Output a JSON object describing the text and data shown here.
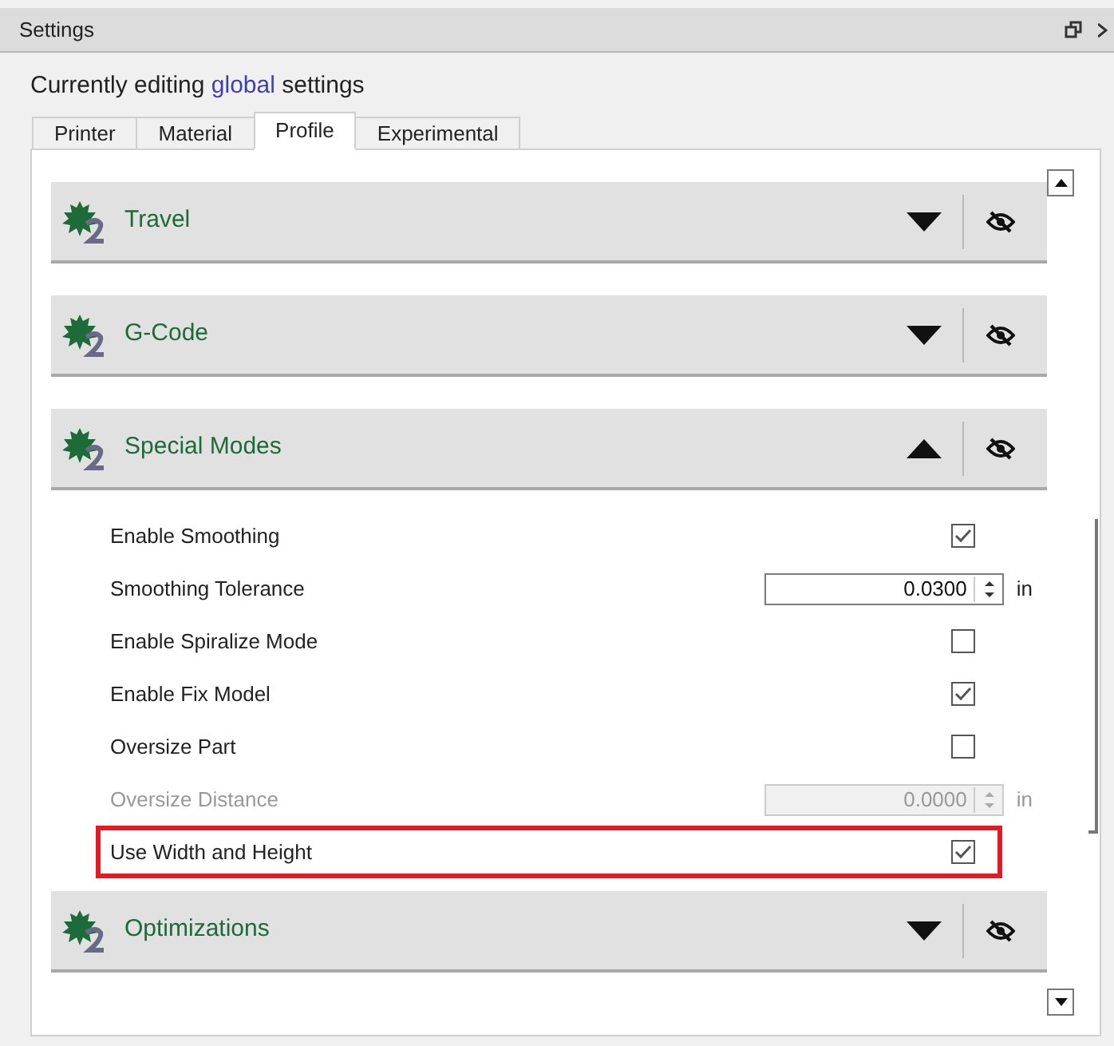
{
  "window": {
    "title": "Settings"
  },
  "editing": "Currently editing **global** settings",
  "tabs": [
    {
      "label": "Printer",
      "selected": false
    },
    {
      "label": "Material",
      "selected": false
    },
    {
      "label": "Profile",
      "selected": true
    },
    {
      "label": "Experimental",
      "selected": false
    }
  ],
  "sections": [
    {
      "title": "Travel",
      "expanded": false
    },
    {
      "title": "G-Code",
      "expanded": false
    },
    {
      "title": "Special Modes",
      "expanded": true,
      "settings": [
        {
          "kind": "checkbox",
          "label": "Enable Smoothing",
          "checked": true,
          "disabled": false,
          "highlighted": false
        },
        {
          "kind": "number",
          "label": "Smoothing Tolerance",
          "value": "0.0300",
          "unit": "in",
          "disabled": false,
          "highlighted": false
        },
        {
          "kind": "checkbox",
          "label": "Enable Spiralize Mode",
          "checked": false,
          "disabled": false,
          "highlighted": false
        },
        {
          "kind": "checkbox",
          "label": "Enable Fix Model",
          "checked": true,
          "disabled": false,
          "highlighted": false
        },
        {
          "kind": "checkbox",
          "label": "Oversize Part",
          "checked": false,
          "disabled": false,
          "highlighted": false
        },
        {
          "kind": "number",
          "label": "Oversize Distance",
          "value": "0.0000",
          "unit": "in",
          "disabled": true,
          "highlighted": false
        },
        {
          "kind": "checkbox",
          "label": "Use Width and Height",
          "checked": true,
          "disabled": false,
          "highlighted": true
        }
      ]
    },
    {
      "title": "Optimizations",
      "expanded": false
    }
  ]
}
